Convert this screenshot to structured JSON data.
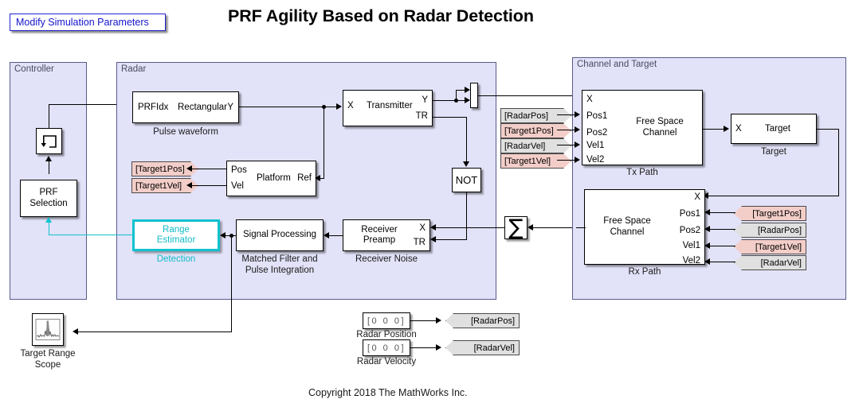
{
  "page": {
    "title": "PRF Agility Based on Radar Detection",
    "copyright": "Copyright 2018 The MathWorks Inc.",
    "link_button": "Modify Simulation Parameters",
    "accent_blue": "#1414cc",
    "accent_cyan": "#0fc2cf",
    "subsystem_fill": "#e2e2f8",
    "tag_pink": "#f3cec9",
    "tag_gray": "#e0e0e0"
  },
  "subsystems": {
    "controller": {
      "label": "Controller"
    },
    "radar": {
      "label": "Radar"
    },
    "channel": {
      "label": "Channel and Target"
    }
  },
  "controller": {
    "delay_icon": "unit-delay-icon",
    "prf_selection": {
      "name": "PRF\nSelection"
    }
  },
  "radar": {
    "pulse_waveform": {
      "name": "Rectangular",
      "port_in": "PRFIdx",
      "port_out": "Y",
      "caption": "Pulse waveform"
    },
    "transmitter": {
      "name": "Transmitter",
      "port_in": "X",
      "port_out_1": "Y",
      "port_out_2": "TR"
    },
    "platform": {
      "name": "Platform",
      "port_in_1": "Pos",
      "port_in_2": "Vel",
      "port_out": "Ref"
    },
    "tags": {
      "target1pos": "[Target1Pos]",
      "target1vel": "[Target1Vel]"
    },
    "range_estimator": {
      "name": "Range\nEstimator",
      "caption": "Detection"
    },
    "signal_processing": {
      "name": "Signal Processing",
      "caption": "Matched Filter and\nPulse Integration"
    },
    "receiver_preamp": {
      "name": "Receiver\nPreamp",
      "port_in_1": "X",
      "port_in_2": "TR",
      "caption": "Receiver Noise"
    },
    "not_block": {
      "label": "NOT"
    },
    "mux": {
      "label": "mux"
    },
    "sum": {
      "label": "∑"
    }
  },
  "channel": {
    "tx_path": {
      "name": "Free Space\nChannel",
      "caption": "Tx Path",
      "ports": [
        "X",
        "Pos1",
        "Pos2",
        "Vel1",
        "Vel2"
      ]
    },
    "rx_path": {
      "name": "Free Space\nChannel",
      "caption": "Rx Path",
      "ports": [
        "X",
        "Pos1",
        "Pos2",
        "Vel1",
        "Vel2"
      ]
    },
    "target": {
      "name": "Target",
      "port_in": "X",
      "caption": "Target"
    },
    "tx_tags": [
      {
        "label": "[RadarPos]",
        "color": "gray"
      },
      {
        "label": "[Target1Pos]",
        "color": "pink"
      },
      {
        "label": "[RadarVel]",
        "color": "gray"
      },
      {
        "label": "[Target1Vel]",
        "color": "pink"
      }
    ],
    "rx_tags": [
      {
        "label": "[Target1Pos]",
        "color": "pink"
      },
      {
        "label": "[RadarPos]",
        "color": "gray"
      },
      {
        "label": "[Target1Vel]",
        "color": "pink"
      },
      {
        "label": "[RadarVel]",
        "color": "gray"
      }
    ]
  },
  "bottom": {
    "scope": {
      "caption": "Target Range\nScope"
    },
    "radar_position": {
      "value": "[0  0  0]",
      "caption": "Radar Position",
      "tag": "[RadarPos]"
    },
    "radar_velocity": {
      "value": "[0  0  0]",
      "caption": "Radar Velocity",
      "tag": "[RadarVel]"
    }
  }
}
